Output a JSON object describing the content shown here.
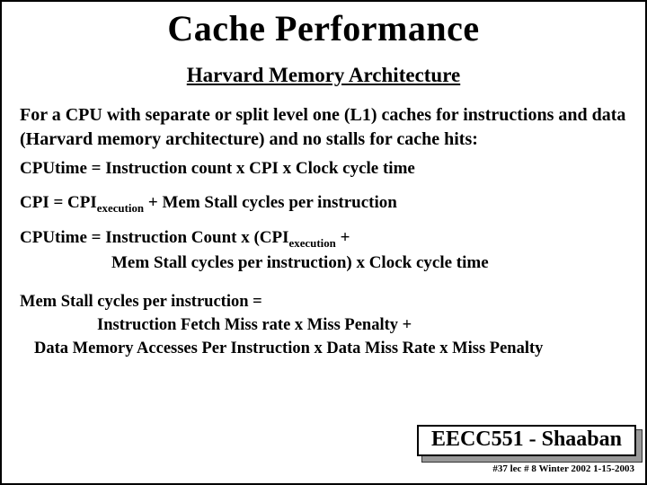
{
  "title": "Cache Performance",
  "subtitle": "Harvard Memory Architecture",
  "para1": "For a CPU with separate or split level  one (L1)  caches for instructions and data  (Harvard memory architecture)  and no stalls for cache hits:",
  "eq1": "CPUtime =   Instruction count x  CPI  x  Clock cycle time",
  "eq2_a": "CPI =    CPI",
  "eq2_sub": "execution",
  "eq2_b": "  +   Mem Stall cycles per instruction",
  "eq3_a": "CPUtime  =  Instruction Count x   (CPI",
  "eq3_sub": "execution",
  "eq3_b": " +",
  "eq3_line2": "Mem Stall  cycles per instruction)   x   Clock cycle time",
  "eq4_line1": "Mem Stall  cycles per instruction =",
  "eq4_line2": "Instruction Fetch Miss rate x Miss Penalty  +",
  "eq4_line3": "Data Memory Accesses Per Instruction x Data Miss Rate x Miss Penalty",
  "footer_course": "EECC551 - Shaaban",
  "footer_sub": "#37  lec # 8   Winter 2002  1-15-2003"
}
